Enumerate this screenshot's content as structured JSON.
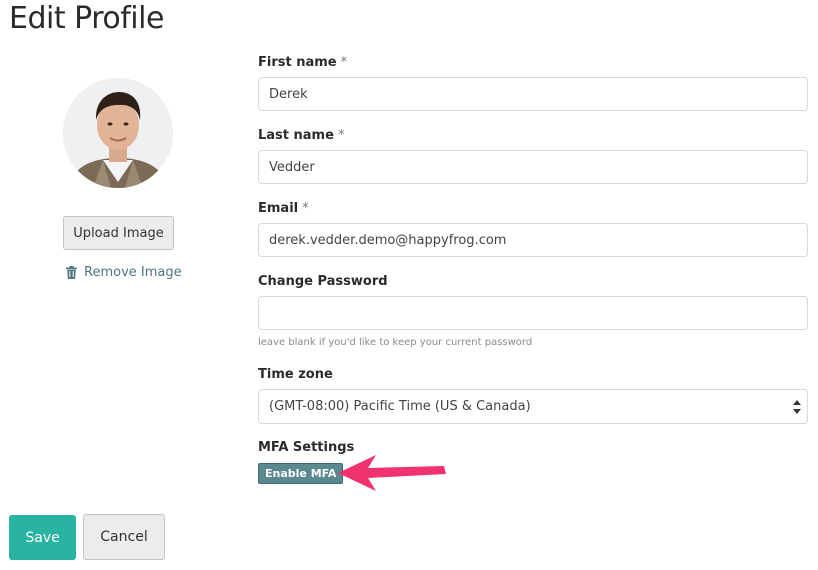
{
  "page": {
    "title": "Edit Profile"
  },
  "profile_image": {
    "upload_label": "Upload Image",
    "remove_label": "Remove Image"
  },
  "form": {
    "first_name": {
      "label": "First name",
      "required_mark": "*",
      "value": "Derek"
    },
    "last_name": {
      "label": "Last name",
      "required_mark": "*",
      "value": "Vedder"
    },
    "email": {
      "label": "Email",
      "required_mark": "*",
      "value": "derek.vedder.demo@happyfrog.com"
    },
    "password": {
      "label": "Change Password",
      "value": "",
      "help": "leave blank if you'd like to keep your current password"
    },
    "time_zone": {
      "label": "Time zone",
      "selected": "(GMT-08:00) Pacific Time (US & Canada)"
    },
    "mfa": {
      "label": "MFA Settings",
      "button_label": "Enable MFA"
    }
  },
  "actions": {
    "save_label": "Save",
    "cancel_label": "Cancel"
  },
  "colors": {
    "save": "#29b4a1",
    "mfa_button": "#5a8a8f",
    "link": "#4d7680",
    "annotation_arrow": "#f0326e"
  },
  "icons": {
    "remove": "trash-icon",
    "select": "select-arrows-icon",
    "annotation": "annotation-arrow"
  }
}
